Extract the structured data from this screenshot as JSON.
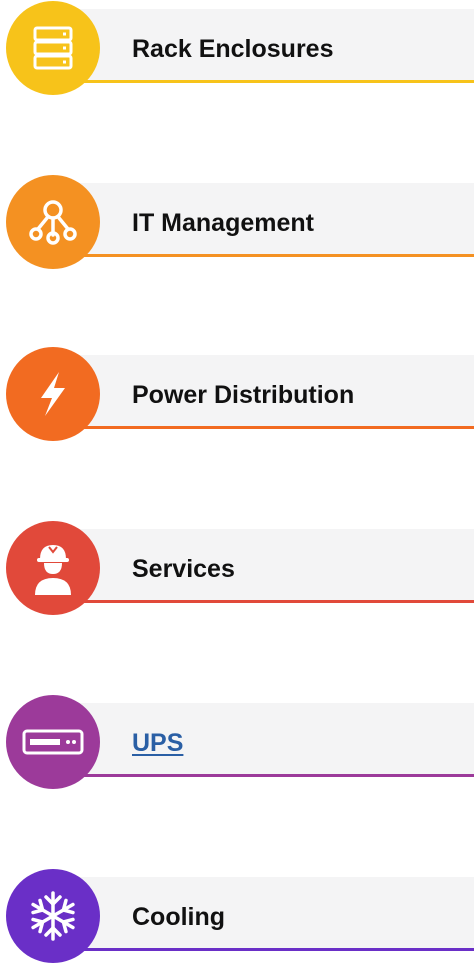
{
  "categories": [
    {
      "label": "Rack Enclosures",
      "icon": "server-rack-icon",
      "color": "#f7c31a",
      "link": false
    },
    {
      "label": "IT Management",
      "icon": "network-hub-icon",
      "color": "#f49122",
      "link": false
    },
    {
      "label": "Power Distribution",
      "icon": "lightning-bolt-icon",
      "color": "#f26b21",
      "link": false
    },
    {
      "label": "Services",
      "icon": "technician-hardhat-icon",
      "color": "#e1493a",
      "link": false
    },
    {
      "label": "UPS",
      "icon": "ups-device-icon",
      "color": "#9c3a9a",
      "link": true
    },
    {
      "label": "Cooling",
      "icon": "snowflake-icon",
      "color": "#6a2fc7",
      "link": false
    }
  ]
}
